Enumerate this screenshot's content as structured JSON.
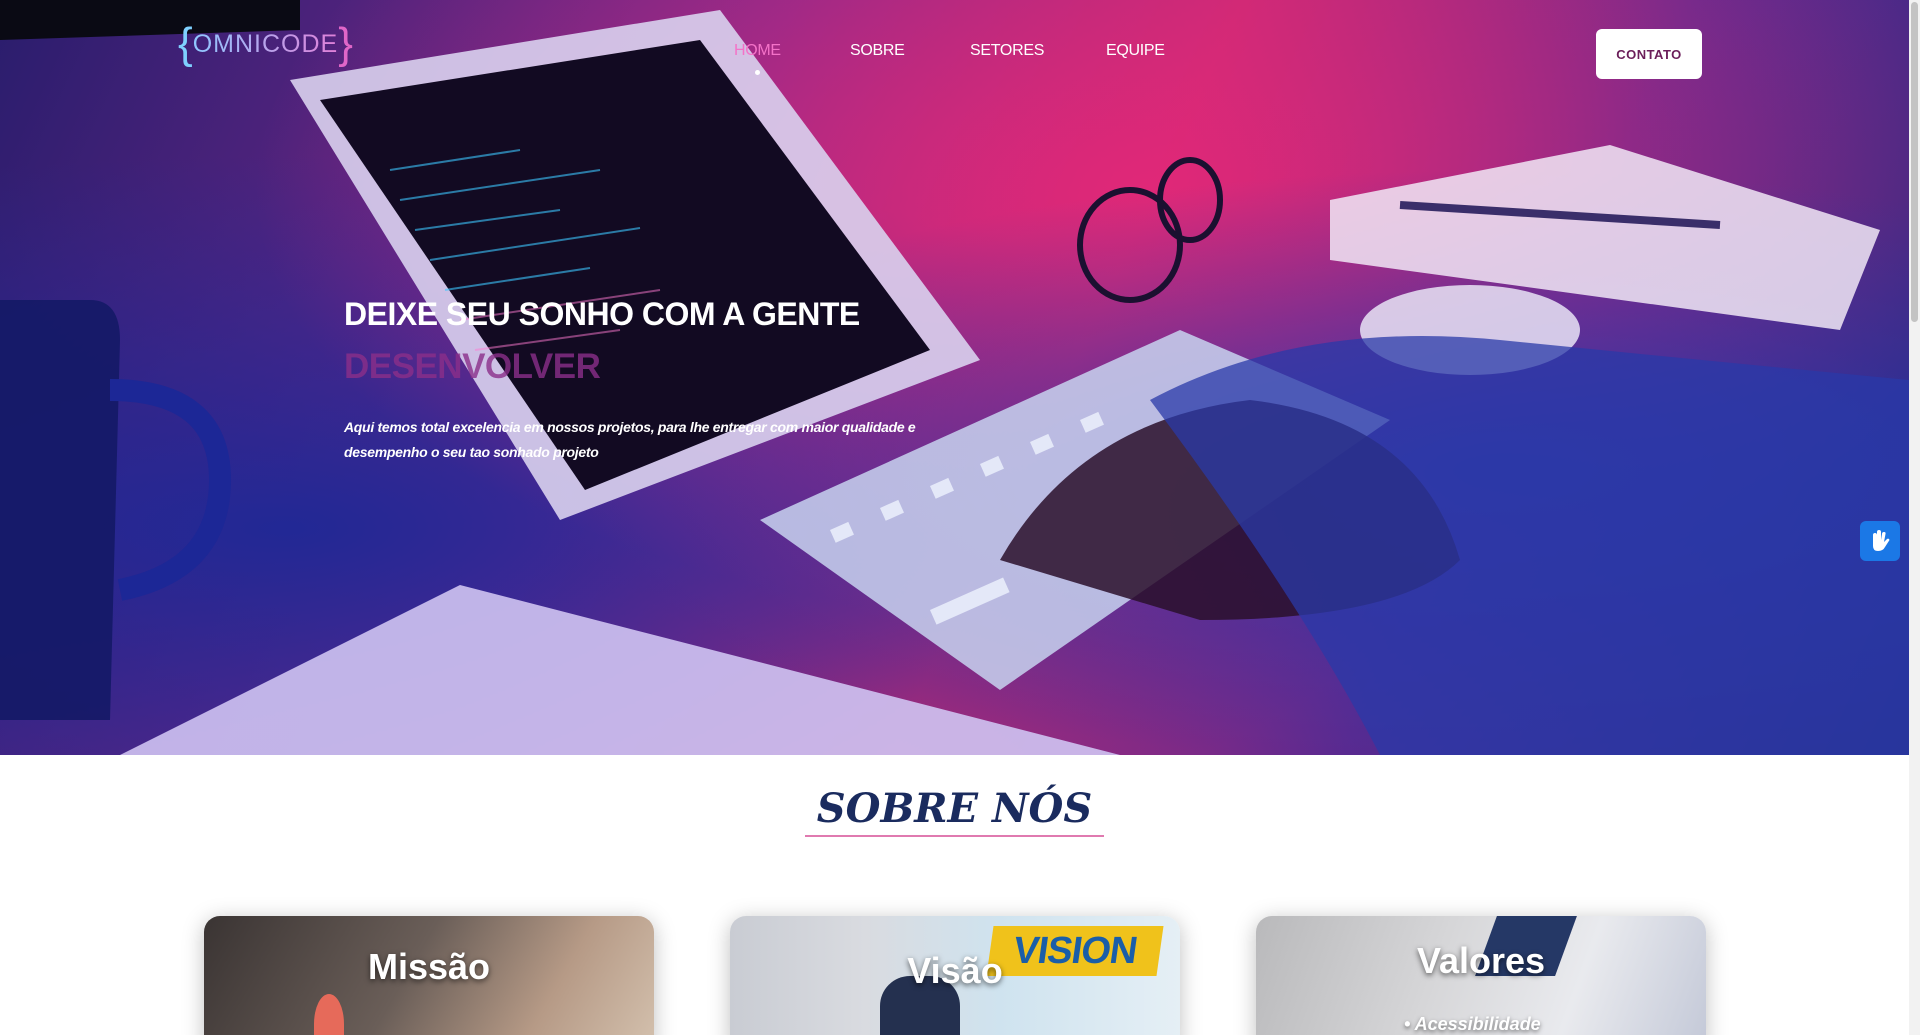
{
  "brand": {
    "logo_left": "{",
    "logo_text": "OMNICODE",
    "logo_right": "}"
  },
  "nav": {
    "items": [
      {
        "label": "HOME",
        "active": true
      },
      {
        "label": "SOBRE",
        "active": false
      },
      {
        "label": "SETORES",
        "active": false
      },
      {
        "label": "EQUIPE",
        "active": false
      }
    ],
    "cta_label": "CONTATO"
  },
  "hero": {
    "title": "DEIXE SEU SONHO COM A GENTE",
    "subtitle": "DESENVOLVER",
    "description": "Aqui temos total excelencia em nossos projetos, para lhe entregar com maior qualidade e desempenho o seu tao sonhado projeto"
  },
  "accessibility": {
    "icon": "sign-language-icon"
  },
  "about": {
    "title": "SOBRE NÓS",
    "cards": [
      {
        "title": "Missão"
      },
      {
        "title": "Visão",
        "sign_text": "VISION"
      },
      {
        "title": "Valores",
        "bullet": "Acessibilidade"
      }
    ]
  },
  "colors": {
    "accent_pink": "#f472c8",
    "subtitle_purple": "#8b2f8a",
    "title_navy": "#1a2b5e",
    "a11y_blue": "#1b78e6"
  }
}
